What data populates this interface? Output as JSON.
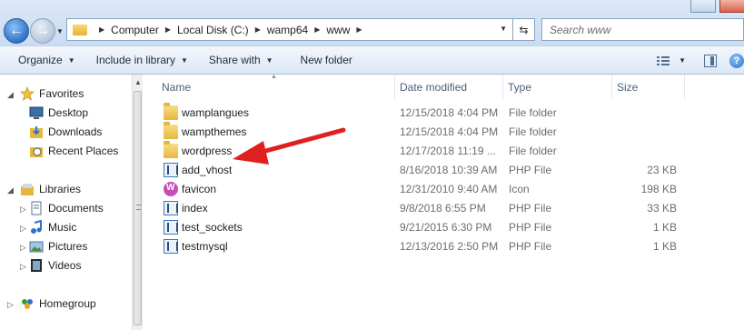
{
  "address_bar": {
    "crumbs": [
      "Computer",
      "Local Disk (C:)",
      "wamp64",
      "www"
    ],
    "search_placeholder": "Search www"
  },
  "toolbar": {
    "organize": "Organize",
    "include_in_library": "Include in library",
    "share_with": "Share with",
    "new_folder": "New folder"
  },
  "nav": {
    "favorites": "Favorites",
    "desktop": "Desktop",
    "downloads": "Downloads",
    "recent_places": "Recent Places",
    "libraries": "Libraries",
    "documents": "Documents",
    "music": "Music",
    "pictures": "Pictures",
    "videos": "Videos",
    "homegroup": "Homegroup"
  },
  "columns": {
    "name": "Name",
    "date_modified": "Date modified",
    "type": "Type",
    "size": "Size"
  },
  "files": [
    {
      "name": "wamplangues",
      "date": "12/15/2018 4:04 PM",
      "type": "File folder",
      "size": "",
      "icon": "folder-icon"
    },
    {
      "name": "wampthemes",
      "date": "12/15/2018 4:04 PM",
      "type": "File folder",
      "size": "",
      "icon": "folder-icon"
    },
    {
      "name": "wordpress",
      "date": "12/17/2018 11:19 ...",
      "type": "File folder",
      "size": "",
      "icon": "folder-icon"
    },
    {
      "name": "add_vhost",
      "date": "8/16/2018 10:39 AM",
      "type": "PHP File",
      "size": "23 KB",
      "icon": "php-file-icon"
    },
    {
      "name": "favicon",
      "date": "12/31/2010 9:40 AM",
      "type": "Icon",
      "size": "198 KB",
      "icon": "ico-file-icon"
    },
    {
      "name": "index",
      "date": "9/8/2018 6:55 PM",
      "type": "PHP File",
      "size": "33 KB",
      "icon": "php-file-icon"
    },
    {
      "name": "test_sockets",
      "date": "9/21/2015 6:30 PM",
      "type": "PHP File",
      "size": "1 KB",
      "icon": "php-file-icon"
    },
    {
      "name": "testmysql",
      "date": "12/13/2016 2:50 PM",
      "type": "PHP File",
      "size": "1 KB",
      "icon": "php-file-icon"
    }
  ],
  "colors": {
    "annotation_arrow": "#e02020",
    "folder": "#e6b73e",
    "accent": "#2f73c8"
  }
}
